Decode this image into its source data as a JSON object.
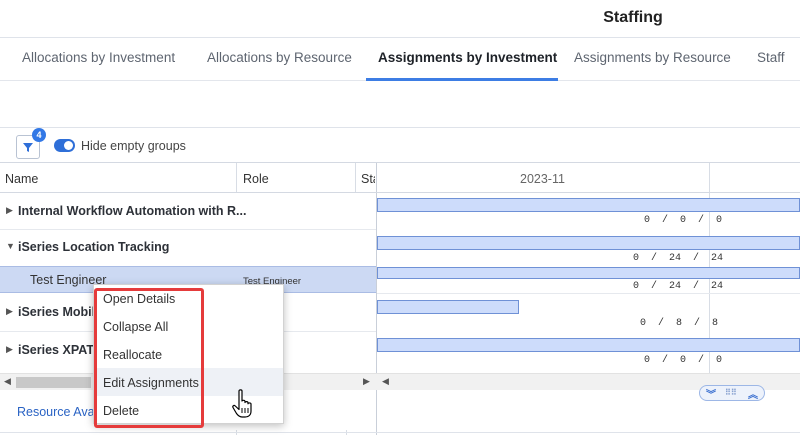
{
  "header": {
    "title": "Staffing"
  },
  "tabs": [
    {
      "label": "Allocations by Investment",
      "active": false
    },
    {
      "label": "Allocations by Resource",
      "active": false
    },
    {
      "label": "Assignments by Investment",
      "active": true
    },
    {
      "label": "Assignments by Resource",
      "active": false
    },
    {
      "label": "Staff",
      "active": false
    }
  ],
  "toolbar": {
    "filter_badge": "4",
    "toggle_label": "Hide empty groups",
    "toggle_on": true
  },
  "grid": {
    "columns": {
      "name": "Name",
      "role": "Role",
      "start": "Sta"
    },
    "period": "2023-11",
    "rows": [
      {
        "name": "Internal Workflow Automation with R...",
        "expanded": false,
        "nums": "0  /  0  /  0"
      },
      {
        "name": "iSeries Location Tracking",
        "expanded": true,
        "nums": "0  /  24  /  24"
      },
      {
        "name": "iSeries Mobile",
        "expanded": false,
        "nums": "0  /  8  /  8"
      },
      {
        "name": "iSeries XPATH",
        "expanded": false,
        "nums": "0  /  0  /  0"
      }
    ],
    "child_row": {
      "name": "Test Engineer",
      "role": "Test Engineer",
      "nums": "0  /  24  /  24"
    }
  },
  "context_menu": {
    "items": [
      "Open Details",
      "Collapse All",
      "Reallocate",
      "Edit Assignments",
      "Delete"
    ],
    "hovered": "Edit Assignments"
  },
  "footer": {
    "link": "Resource Avai"
  },
  "colors": {
    "accent": "#3d7de4",
    "highlight": "#e53b3b",
    "bar_fill": "#cddcfb"
  }
}
